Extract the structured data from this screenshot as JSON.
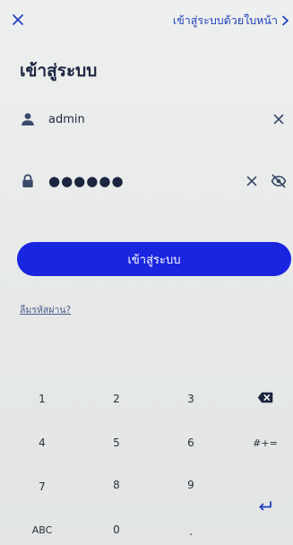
{
  "topbar": {
    "close_icon": "close-icon",
    "face_login_label": "เข้าสู่ระบบด้วยใบหน้า",
    "face_login_icon": "chevron-right-icon"
  },
  "title": "เข้าสู่ระบบ",
  "username": {
    "icon": "user-icon",
    "value": "admin",
    "clear_icon": "clear-icon"
  },
  "password": {
    "icon": "lock-icon",
    "value": "●●●●●●",
    "clear_icon": "clear-icon",
    "visibility_icon": "eye-off-icon"
  },
  "login_button_label": "เข้าสู่ระบบ",
  "forgot_password_label": "ลืมรหัสผ่าน?",
  "keypad": {
    "keys": [
      "1",
      "2",
      "3",
      "4",
      "5",
      "6",
      "7",
      "8",
      "9",
      "ABC",
      "0",
      "."
    ],
    "backspace_icon": "backspace-icon",
    "symbols_label": "#+=",
    "enter_icon": "enter-icon"
  },
  "colors": {
    "accent": "#1a25e0",
    "link": "#1f3fbf",
    "text": "#1b2540"
  }
}
